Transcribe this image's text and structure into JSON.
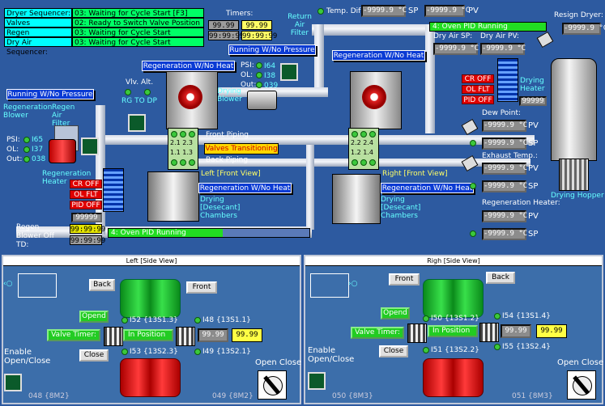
{
  "sequencers": [
    {
      "label": "Dryer Sequencer:",
      "value": "03: Waiting for Cycle Start [F3]"
    },
    {
      "label": "Valves Sequencer:",
      "value": "02: Ready to Switch Valve Position"
    },
    {
      "label": "Regen Sequencer:",
      "value": "03: Waiting for Cycle Start"
    },
    {
      "label": "Dry Air Sequencer:",
      "value": "03: Waiting for Cycle Start"
    }
  ],
  "timers": {
    "label": "Timers:",
    "row1": [
      "99.99",
      "99.99"
    ],
    "row2": [
      "99:99:99",
      "99:99:99"
    ]
  },
  "top": {
    "return_air_filter": "Return Air Filter",
    "temp_dif_label": "Temp. Dif:",
    "temp_dif_value": "-9999.9 °C",
    "sp": "SP",
    "sp_value": "-9999.9 °C",
    "pv": "PV",
    "resign_dryer": "Resign Dryer:",
    "resign_value": "-9999.9 °C",
    "oven_pid_top": "4: Oven PID Running",
    "dry_air_sp_label": "Dry Air SP:",
    "dry_air_pv_label": "Dry Air PV:",
    "dry_air_sp": "-9999.9 °C",
    "dry_air_pv": "-9999.9 °C"
  },
  "running_wno_pressure_top": "Running W/No Pressure",
  "running_wno_pressure_left": "Running W/No Pressure",
  "drying_blower": {
    "psi": "PSI:",
    "psi_v": "I64",
    "ol": "OL:",
    "ol_v": "I38",
    "out": "Out:",
    "out_v": "039",
    "name": "Drying Blower"
  },
  "regen_blower": {
    "psi": "PSI:",
    "psi_v": "I65",
    "ol": "OL:",
    "ol_v": "I37",
    "out": "Out:",
    "out_v": "038",
    "name": "Regeneration Blower",
    "name2": "Regen Air Filter"
  },
  "vlv_alt": {
    "label": "Vlv. Alt.",
    "sub": "RG TO DP"
  },
  "regen_heater": {
    "name": "Regeneration Heater",
    "alarms": [
      "CR OFF",
      "OL FLT",
      "PID OFF"
    ],
    "value": "99999"
  },
  "drying_heater": {
    "name": "Drying Heater",
    "alarms": [
      "CR OFF",
      "OL FLT",
      "PID OFF"
    ],
    "value": "99999"
  },
  "regen_blower_off": {
    "label": "Regen Blower Off TD:",
    "v1": "99:99:99",
    "v2": "99:99:99"
  },
  "left_chamber": {
    "banner_top": "Regeneration W/No Heat",
    "banner_bottom": "Regeneration W/No Heat",
    "view": "Left [Front View]",
    "desc": "Drying [Desecant] Chambers",
    "codes": [
      "2.1",
      "2.3",
      "1.1",
      "1.3"
    ]
  },
  "right_chamber": {
    "banner_top": "Regeneration W/No Heat",
    "banner_bottom": "Regeneration W/No Heat",
    "view": "Right [Front View]",
    "desc": "Drying [Desecant] Chambers",
    "codes": [
      "2.2",
      "2.4",
      "1.2",
      "1.4"
    ]
  },
  "piping": {
    "front": "Front Piping",
    "back": "Back Piping",
    "transitioning": "Valves Transitioning"
  },
  "right_side": {
    "dew_point": "Dew Point:",
    "dew_pv": "-9999.9 °C",
    "dew_sp": "-9999.9 °C",
    "exhaust": "Exhaust Temp.:",
    "exh_pv": "-9999.9 °C",
    "exh_sp": "-9999.9 °C",
    "regen_heater": "Regeneration Heater:",
    "rh_pv": "-9999.9 °C",
    "rh_sp": "-9999.9 °C",
    "pv": "PV",
    "sp": "SP",
    "hopper": "Drying Hopper"
  },
  "oven_pid_bottom": "4: Oven PID Running",
  "left_panel": {
    "title": "Left [Side View]",
    "back": "Back",
    "front": "Front",
    "opend": "Opend",
    "close": "Close",
    "valve_timer": "Valve Timer:",
    "in_position": "In Position",
    "t1": "99.99",
    "t2": "99.99",
    "i52": "I52 {13S1.3}",
    "i48": "I48 {13S1.1}",
    "i53": "I53 {13S2.3}",
    "i49": "I49 {13S2.1}",
    "enable": "Enable Open/Close",
    "open_close": "Open Close",
    "o48": "048 {8M2}",
    "o49": "049 {8M2}"
  },
  "right_panel": {
    "title": "Righ [Side View]",
    "front": "Front",
    "back": "Back",
    "opend": "Opend",
    "close": "Close",
    "valve_timer": "Valve Timer:",
    "in_position": "In Position",
    "t1": "99.99",
    "t2": "99.99",
    "i50": "I50 {13S1.2}",
    "i54": "I54 {13S1.4}",
    "i51": "I51 {13S2.2}",
    "i55": "I55 {13S2.4}",
    "enable": "Enable Open/Close",
    "open_close": "Open Close",
    "o50": "050 {8M3}",
    "o51": "051 {8M3}"
  },
  "colors": {
    "background": "#2d5aa0",
    "accent": "#00ff66",
    "alarm": "#e00000"
  }
}
